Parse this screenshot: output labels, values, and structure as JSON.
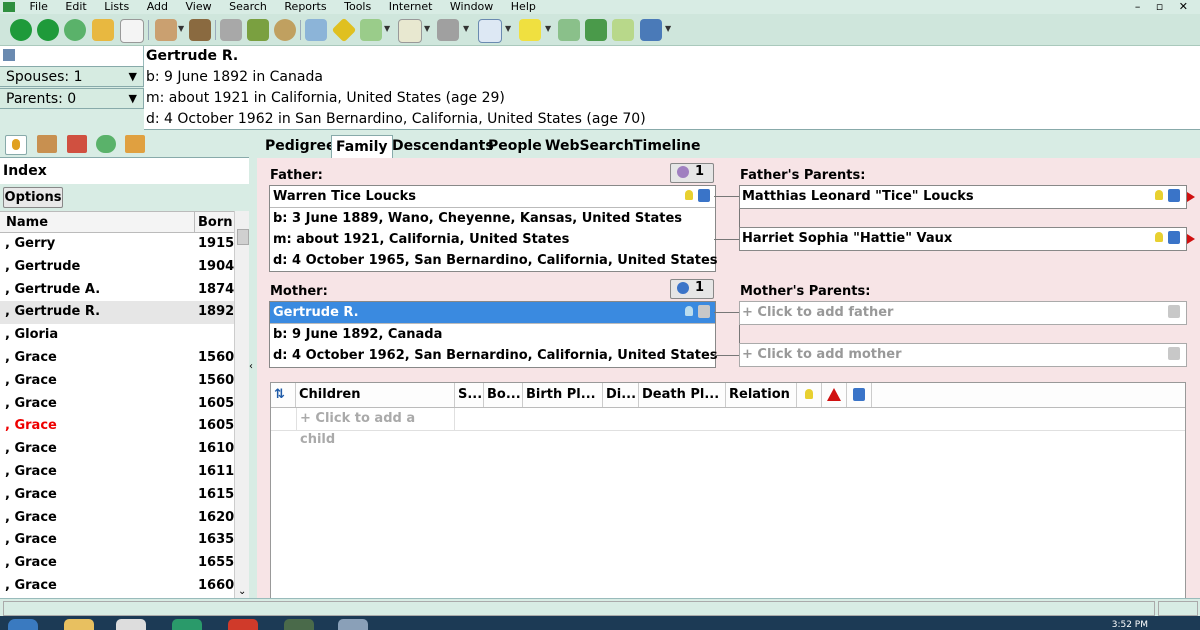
{
  "menu": [
    "File",
    "Edit",
    "Lists",
    "Add",
    "View",
    "Search",
    "Reports",
    "Tools",
    "Internet",
    "Window",
    "Help"
  ],
  "window_controls": "– ▫ ✕",
  "toolbar_icons": [
    "back-icon",
    "forward-icon",
    "refresh-icon",
    "open-folder-icon",
    "new-file-icon",
    "add-person-icon",
    "person-icon",
    "print-icon",
    "books-icon",
    "search-icon",
    "tree-icon",
    "navigate-icon",
    "tag-icon",
    "list-icon",
    "media-icon",
    "card-icon",
    "note-icon",
    "chart-icon",
    "home-icon",
    "exit-icon",
    "panel-icon"
  ],
  "summary": {
    "spouses": "Spouses: 1",
    "parents": "Parents: 0",
    "name": "Gertrude R.",
    "birth": "b: 9 June 1892 in Canada",
    "marriage": "m: about 1921 in California, United States (age 29)",
    "death": "d: 4 October 1962 in San Bernardino, California, United States (age 70)"
  },
  "left_panel": {
    "tab_icons": [
      "index-person-icon",
      "family-group-icon",
      "bookmark-icon",
      "history-icon",
      "groups-icon"
    ],
    "title": "Index",
    "options_label": "Options",
    "columns": [
      "Name",
      "Born"
    ],
    "rows": [
      {
        "name": ", Gerry",
        "born": "1915"
      },
      {
        "name": ", Gertrude",
        "born": "1904"
      },
      {
        "name": ", Gertrude A.",
        "born": "1874"
      },
      {
        "name": ", Gertrude R.",
        "born": "1892"
      },
      {
        "name": ", Gloria",
        "born": ""
      },
      {
        "name": ", Grace",
        "born": "1560"
      },
      {
        "name": ", Grace",
        "born": "1560"
      },
      {
        "name": ", Grace",
        "born": "1605"
      },
      {
        "name": ", Grace",
        "born": "1605"
      },
      {
        "name": ", Grace",
        "born": "1610"
      },
      {
        "name": ", Grace",
        "born": "1611"
      },
      {
        "name": ", Grace",
        "born": "1615"
      },
      {
        "name": ", Grace",
        "born": "1620"
      },
      {
        "name": ", Grace",
        "born": "1635"
      },
      {
        "name": ", Grace",
        "born": "1655"
      },
      {
        "name": ", Grace",
        "born": "1660"
      }
    ],
    "scroll_down": "⌄"
  },
  "view_tabs": [
    "Pedigree",
    "Family",
    "Descendants",
    "People",
    "WebSearch",
    "Timeline"
  ],
  "family": {
    "father_label": "Father:",
    "father_count": "1",
    "father": {
      "name": "Warren Tice Loucks",
      "birth": "b: 3 June 1889, Wano, Cheyenne, Kansas, United States",
      "marriage": "m: about 1921, California, United States",
      "death": "d: 4 October 1965, San Bernardino, California, United States"
    },
    "mother_label": "Mother:",
    "mother_count": "1",
    "mother": {
      "name": "Gertrude R.",
      "birth": "b: 9 June 1892, Canada",
      "death": "d: 4 October 1962, San Bernardino, California, United States"
    },
    "fathers_parents_label": "Father's Parents:",
    "paternal_grandfather": "Matthias Leonard \"Tice\" Loucks",
    "paternal_grandmother": "Harriet Sophia \"Hattie\" Vaux",
    "mothers_parents_label": "Mother's Parents:",
    "add_father": "+ Click to add father",
    "add_mother": "+ Click to add mother",
    "children_columns": [
      "⇅",
      "Children",
      "S...",
      "Bo...",
      "Birth Pl...",
      "Di...",
      "Death Pl...",
      "Relation"
    ],
    "add_child": "+ Click to add a child"
  },
  "taskbar": {
    "time": "3:52 PM"
  },
  "colors": {
    "selected": "#3a8ae0",
    "family_bg": "#f7e4e6",
    "chrome": "#d8ece4",
    "accent_red": "#e00000"
  }
}
